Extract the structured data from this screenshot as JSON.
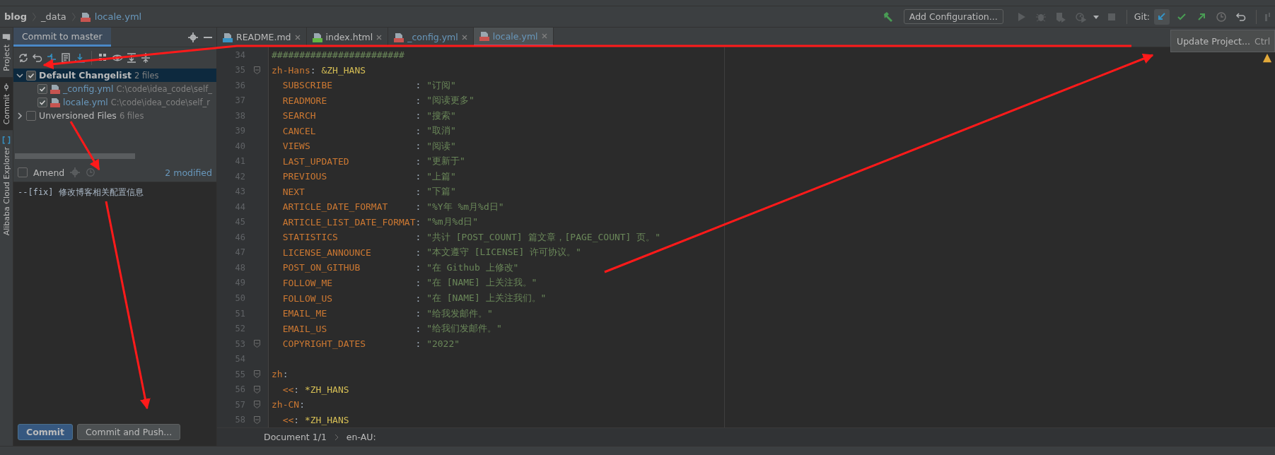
{
  "breadcrumb": [
    {
      "label": "blog",
      "kind": "project"
    },
    {
      "label": "_data",
      "kind": "folder"
    },
    {
      "label": "locale.yml",
      "kind": "file"
    }
  ],
  "toolbar": {
    "run_config": "Add Configuration...",
    "git_label": "Git:",
    "git_actions": [
      {
        "kind": "update",
        "selected": true
      },
      {
        "kind": "commit",
        "selected": false
      },
      {
        "kind": "push",
        "selected": false
      },
      {
        "kind": "history",
        "selected": false
      },
      {
        "kind": "rollback",
        "selected": false
      }
    ]
  },
  "tooltip": {
    "text": "Update Project...",
    "shortcut": "Ctrl"
  },
  "tool_strip": [
    {
      "label": "Project",
      "kind": "project",
      "selected": false
    },
    {
      "label": "Commit",
      "kind": "commit",
      "selected": true
    },
    {
      "label": "Alibaba Cloud Explorer",
      "kind": "cloud",
      "selected": false
    }
  ],
  "commit_panel": {
    "title": "Commit to master",
    "tree": [
      {
        "label": "Default Changelist",
        "count": "2 files",
        "checked": true,
        "expanded": true,
        "selected": true,
        "children": [
          {
            "label": "_config.yml",
            "path": "C:\\code\\idea_code\\self_",
            "checked": true,
            "selected": false
          },
          {
            "label": "locale.yml",
            "path": "C:\\code\\idea_code\\self_r",
            "checked": true,
            "selected": false
          }
        ]
      },
      {
        "label": "Unversioned Files",
        "count": "6 files",
        "checked": false,
        "expanded": false,
        "selected": false
      }
    ],
    "amend": {
      "label": "Amend",
      "checked": false
    },
    "modified": "2 modified",
    "message": "--[fix] 修改博客相关配置信息",
    "buttons": [
      {
        "label": "Commit",
        "kind": "primary"
      },
      {
        "label": "Commit and Push...",
        "kind": "secondary"
      }
    ]
  },
  "editor": {
    "tabs": [
      {
        "label": "README.md",
        "kind": "markdown",
        "modified": false,
        "selected": false
      },
      {
        "label": "index.html",
        "kind": "html",
        "modified": false,
        "selected": false
      },
      {
        "label": "_config.yml",
        "kind": "yaml",
        "modified": true,
        "selected": false
      },
      {
        "label": "locale.yml",
        "kind": "yaml",
        "modified": true,
        "selected": true
      }
    ],
    "lines": [
      {
        "number": "34",
        "kind": "comment",
        "text": "########################"
      },
      {
        "number": "35",
        "kind": "mapping",
        "key": "zh-Hans",
        "colon": ":",
        "anchor": "&ZH_HANS",
        "fold": true,
        "children": [
          {
            "number": "36",
            "kind": "pair",
            "key": "SUBSCRIBE",
            "colon": ":",
            "value": "\"订阅\""
          },
          {
            "number": "37",
            "kind": "pair",
            "key": "READMORE",
            "colon": ":",
            "value": "\"阅读更多\""
          },
          {
            "number": "38",
            "kind": "pair",
            "key": "SEARCH",
            "colon": ":",
            "value": "\"搜索\""
          },
          {
            "number": "39",
            "kind": "pair",
            "key": "CANCEL",
            "colon": ":",
            "value": "\"取消\""
          },
          {
            "number": "40",
            "kind": "pair",
            "key": "VIEWS",
            "colon": ":",
            "value": "\"阅读\""
          },
          {
            "number": "41",
            "kind": "pair",
            "key": "LAST_UPDATED",
            "colon": ":",
            "value": "\"更新于\""
          },
          {
            "number": "42",
            "kind": "pair",
            "key": "PREVIOUS",
            "colon": ":",
            "value": "\"上篇\""
          },
          {
            "number": "43",
            "kind": "pair",
            "key": "NEXT",
            "colon": ":",
            "value": "\"下篇\""
          },
          {
            "number": "44",
            "kind": "pair",
            "key": "ARTICLE_DATE_FORMAT",
            "colon": ":",
            "value": "\"%Y年 %m月%d日\""
          },
          {
            "number": "45",
            "kind": "pair",
            "key": "ARTICLE_LIST_DATE_FORMAT",
            "colon": ":",
            "value": "\"%m月%d日\""
          },
          {
            "number": "46",
            "kind": "pair",
            "key": "STATISTICS",
            "colon": ":",
            "value": "\"共计 [POST_COUNT] 篇文章，[PAGE_COUNT] 页。\""
          },
          {
            "number": "47",
            "kind": "pair",
            "key": "LICENSE_ANNOUNCE",
            "colon": ":",
            "value": "\"本文遵守 [LICENSE] 许可协议。\""
          },
          {
            "number": "48",
            "kind": "pair",
            "key": "POST_ON_GITHUB",
            "colon": ":",
            "value": "\"在 Github 上修改\""
          },
          {
            "number": "49",
            "kind": "pair",
            "key": "FOLLOW_ME",
            "colon": ":",
            "value": "\"在 [NAME] 上关注我。\""
          },
          {
            "number": "50",
            "kind": "pair",
            "key": "FOLLOW_US",
            "colon": ":",
            "value": "\"在 [NAME] 上关注我们。\""
          },
          {
            "number": "51",
            "kind": "pair",
            "key": "EMAIL_ME",
            "colon": ":",
            "value": "\"给我发邮件。\""
          },
          {
            "number": "52",
            "kind": "pair",
            "key": "EMAIL_US",
            "colon": ":",
            "value": "\"给我们发邮件。\""
          },
          {
            "number": "53",
            "kind": "pair",
            "key": "COPYRIGHT_DATES",
            "colon": ":",
            "value": "\"2022\"",
            "fold": true
          }
        ]
      },
      {
        "number": "54",
        "kind": "blank"
      },
      {
        "number": "55",
        "kind": "mapping",
        "key": "zh",
        "colon": ":",
        "fold": true,
        "children": [
          {
            "number": "56",
            "kind": "merge",
            "key": "<<",
            "colon": ":",
            "anchor": "*ZH_HANS",
            "fold": true
          }
        ]
      },
      {
        "number": "57",
        "kind": "mapping",
        "key": "zh-CN",
        "colon": ":",
        "fold": true,
        "children": [
          {
            "number": "58",
            "kind": "merge",
            "key": "<<",
            "colon": ":",
            "anchor": "*ZH_HANS",
            "fold": true
          }
        ]
      }
    ],
    "path": [
      "Document 1/1",
      "en-AU:"
    ]
  }
}
